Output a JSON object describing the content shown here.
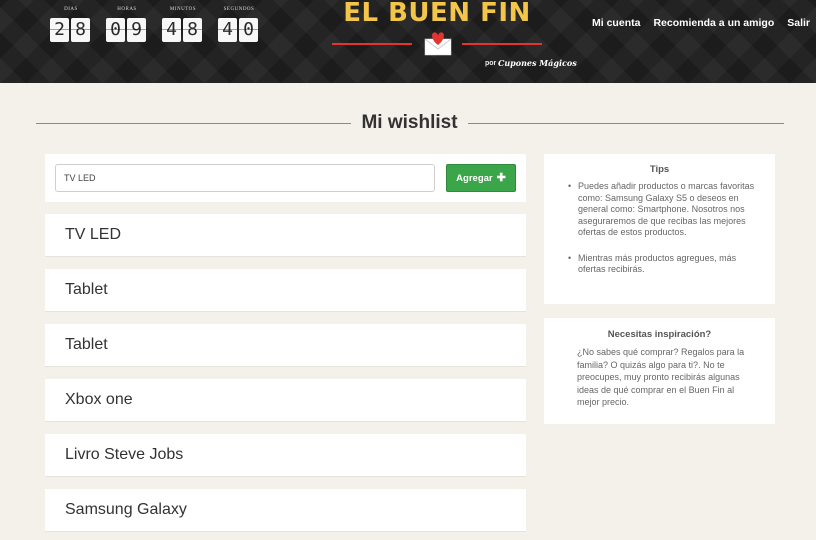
{
  "header": {
    "countdown": [
      {
        "label": "DIAS",
        "value": "28"
      },
      {
        "label": "HORAS",
        "value": "09"
      },
      {
        "label": "MINUTOS",
        "value": "48"
      },
      {
        "label": "SEGUNDOS",
        "value": "40"
      }
    ],
    "logo_title": "EL BUEN FIN",
    "logo_by": "por",
    "logo_brand": "Cupones Mágicos",
    "nav": [
      "Mi cuenta",
      "Recomienda a un amigo",
      "Salir"
    ]
  },
  "page_title": "Mi wishlist",
  "add_form": {
    "input_value": "TV LED",
    "button_label": "Agregar",
    "button_icon": "plus-icon"
  },
  "wishlist": [
    "TV LED",
    "Tablet",
    "Tablet",
    "Xbox one",
    "Livro Steve Jobs",
    "Samsung Galaxy"
  ],
  "tips": {
    "title": "Tips",
    "items": [
      "Puedes añadir productos o marcas favoritas como: Samsung Galaxy S5 o deseos en general como: Smartphone. Nosotros nos aseguraremos de que recibas las mejores ofertas de estos productos.",
      "Mientras más productos agregues, más ofertas recibirás."
    ]
  },
  "inspiration": {
    "title": "Necesitas inspiración?",
    "text": "¿No sabes qué comprar? Regalos para la familia? O quizás algo para ti?. No te preocupes, muy pronto recibirás algunas ideas de qué comprar en el Buen Fin al mejor precio."
  },
  "colors": {
    "header_bg": "#1c1c1c",
    "logo_yellow": "#f3c64a",
    "accent_red": "#e3342f",
    "button_green": "#3aa549",
    "page_bg": "#f4f0ea"
  }
}
